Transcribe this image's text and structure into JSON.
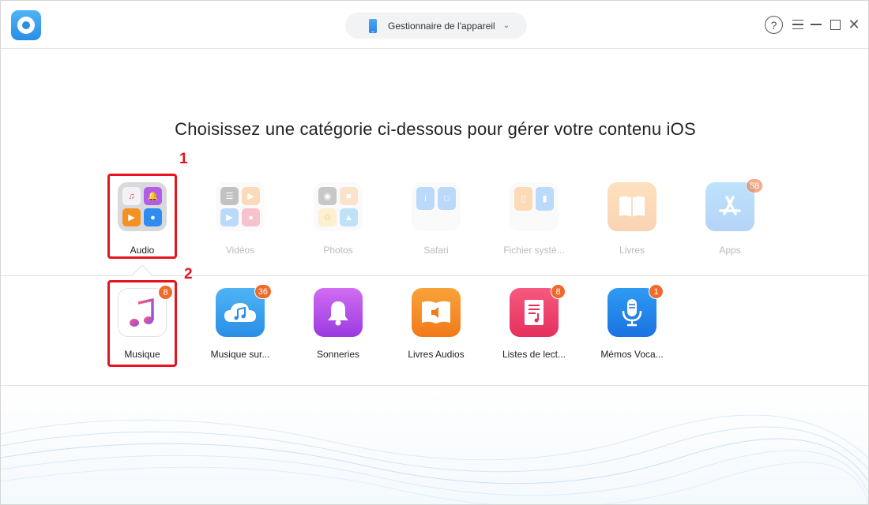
{
  "titlebar": {
    "device_selector_label": "Gestionnaire de l'appareil",
    "help_glyph": "?"
  },
  "headline": "Choisissez une catégorie ci-dessous pour gérer votre contenu iOS",
  "categories": [
    {
      "label": "Audio",
      "icon": "audio-grid-icon",
      "active": true
    },
    {
      "label": "Vidéos",
      "icon": "videos-grid-icon",
      "active": false
    },
    {
      "label": "Photos",
      "icon": "photos-grid-icon",
      "active": false
    },
    {
      "label": "Safari",
      "icon": "safari-grid-icon",
      "active": false
    },
    {
      "label": "Fichier systè...",
      "icon": "system-files-grid-icon",
      "active": false
    },
    {
      "label": "Livres",
      "icon": "books-icon",
      "active": false
    },
    {
      "label": "Apps",
      "icon": "app-store-icon",
      "active": false,
      "badge": "58"
    }
  ],
  "audio_items": [
    {
      "label": "Musique",
      "icon": "music-note-icon",
      "badge": "8"
    },
    {
      "label": "Musique sur...",
      "icon": "cloud-music-icon",
      "badge": "36"
    },
    {
      "label": "Sonneries",
      "icon": "bell-icon"
    },
    {
      "label": "Livres Audios",
      "icon": "audiobook-icon"
    },
    {
      "label": "Listes de lect...",
      "icon": "playlist-icon",
      "badge": "8"
    },
    {
      "label": "Mémos Voca...",
      "icon": "microphone-icon",
      "badge": "1"
    }
  ],
  "annotations": {
    "step1": "1",
    "step2": "2",
    "highlight_color": "#e8141d"
  },
  "colors": {
    "accent": "#2a8ee6",
    "badge": "#f06a2c"
  }
}
